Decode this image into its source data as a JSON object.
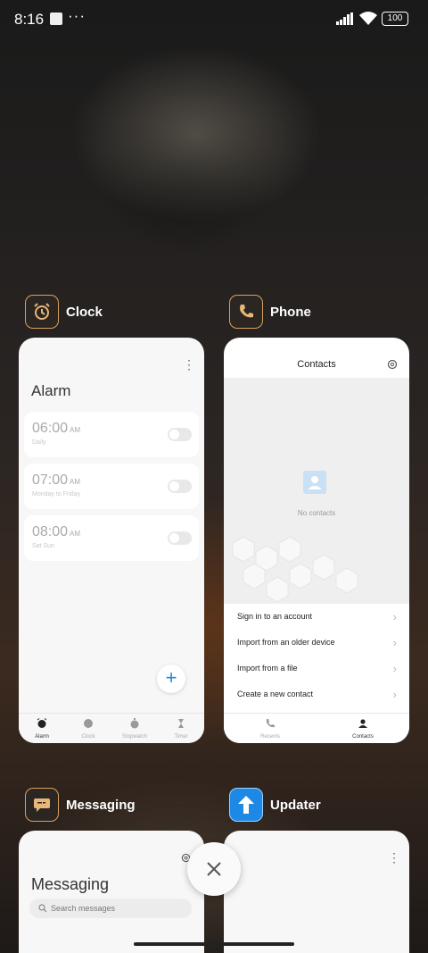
{
  "status_bar": {
    "time": "8:16",
    "dots": "···",
    "battery": "100"
  },
  "apps": {
    "clock": {
      "name": "Clock",
      "title": "Alarm",
      "alarms": [
        {
          "time": "06:00",
          "ampm": "AM",
          "repeat": "Daily"
        },
        {
          "time": "07:00",
          "ampm": "AM",
          "repeat": "Monday to Friday"
        },
        {
          "time": "08:00",
          "ampm": "AM",
          "repeat": "Sat Sun"
        }
      ],
      "nav": [
        "Alarm",
        "Clock",
        "Stopwatch",
        "Timer"
      ],
      "fab": "+"
    },
    "phone": {
      "name": "Phone",
      "title": "Contacts",
      "empty": "No contacts",
      "menu": [
        "Sign in to an account",
        "Import from an older device",
        "Import from a file",
        "Create a new contact"
      ],
      "nav": [
        "Recents",
        "Contacts"
      ]
    },
    "messaging": {
      "name": "Messaging",
      "title": "Messaging",
      "search_placeholder": "Search messages"
    },
    "updater": {
      "name": "Updater"
    }
  },
  "close_symbol": "✕",
  "colors": {
    "accent": "#1e88e5",
    "icon_border": "#d9a05e"
  }
}
